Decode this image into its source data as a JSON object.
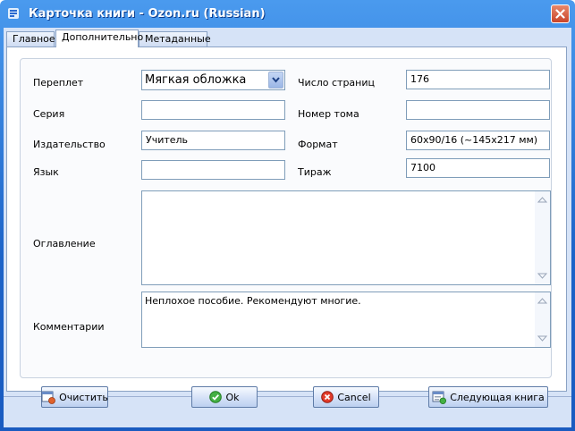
{
  "window": {
    "title": "Карточка книги - Ozon.ru (Russian)"
  },
  "tabs": [
    {
      "label": "Главное"
    },
    {
      "label": "Дополнительно"
    },
    {
      "label": "Метаданные"
    }
  ],
  "form": {
    "binding": {
      "label": "Переплет",
      "value": "Мягкая обложка"
    },
    "series": {
      "label": "Серия",
      "value": ""
    },
    "publisher": {
      "label": "Издательство",
      "value": "Учитель"
    },
    "language": {
      "label": "Язык",
      "value": ""
    },
    "pages": {
      "label": "Число страниц",
      "value": "176"
    },
    "volume": {
      "label": "Номер тома",
      "value": ""
    },
    "format": {
      "label": "Формат",
      "value": "60x90/16 (~145x217 мм)"
    },
    "print_run": {
      "label": "Тираж",
      "value": "7100"
    },
    "toc": {
      "label": "Оглавление",
      "value": ""
    },
    "comments": {
      "label": "Комментарии",
      "value": "Неплохое пособие. Рекомендуют многие."
    }
  },
  "buttons": {
    "clear": "Очистить",
    "ok": "Ok",
    "cancel": "Cancel",
    "next": "Следующая книга"
  }
}
